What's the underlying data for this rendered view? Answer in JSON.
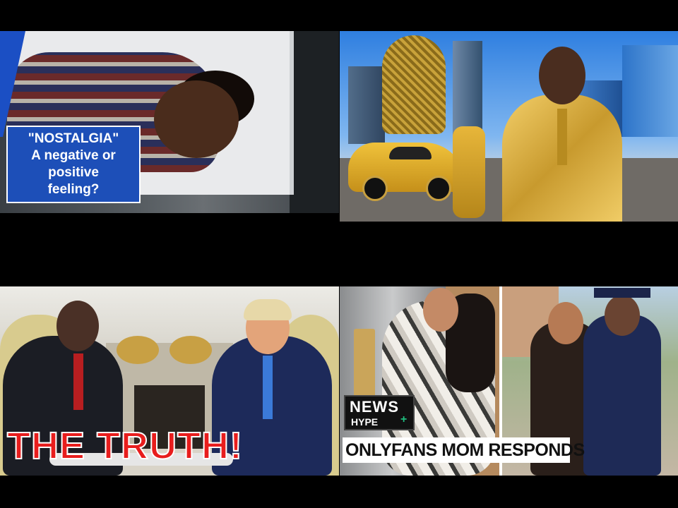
{
  "thumbnails": [
    {
      "id": "nostalgia",
      "caption_lines": [
        "\"NOSTALGIA\"",
        "A negative or",
        "positive",
        "feeling?"
      ],
      "colors": {
        "caption_bg": "#1d4fb8",
        "caption_text": "#ffffff"
      }
    },
    {
      "id": "gold-suit-city",
      "colors": {
        "accent": "#d4a93a",
        "sky": "#2f7fe0"
      }
    },
    {
      "id": "oval-office",
      "overlay_text": "THE TRUTH!",
      "colors": {
        "overlay_text": "#e81d1d"
      }
    },
    {
      "id": "onlyfans-mom",
      "badge": {
        "line1": "NEWS",
        "line2": "HYPE",
        "plus": "+"
      },
      "headline": "ONLYFANS MOM RESPONDS",
      "colors": {
        "badge_bg": "#111111",
        "badge_plus": "#1fbe7f",
        "headline_bg": "#ffffff"
      }
    }
  ]
}
